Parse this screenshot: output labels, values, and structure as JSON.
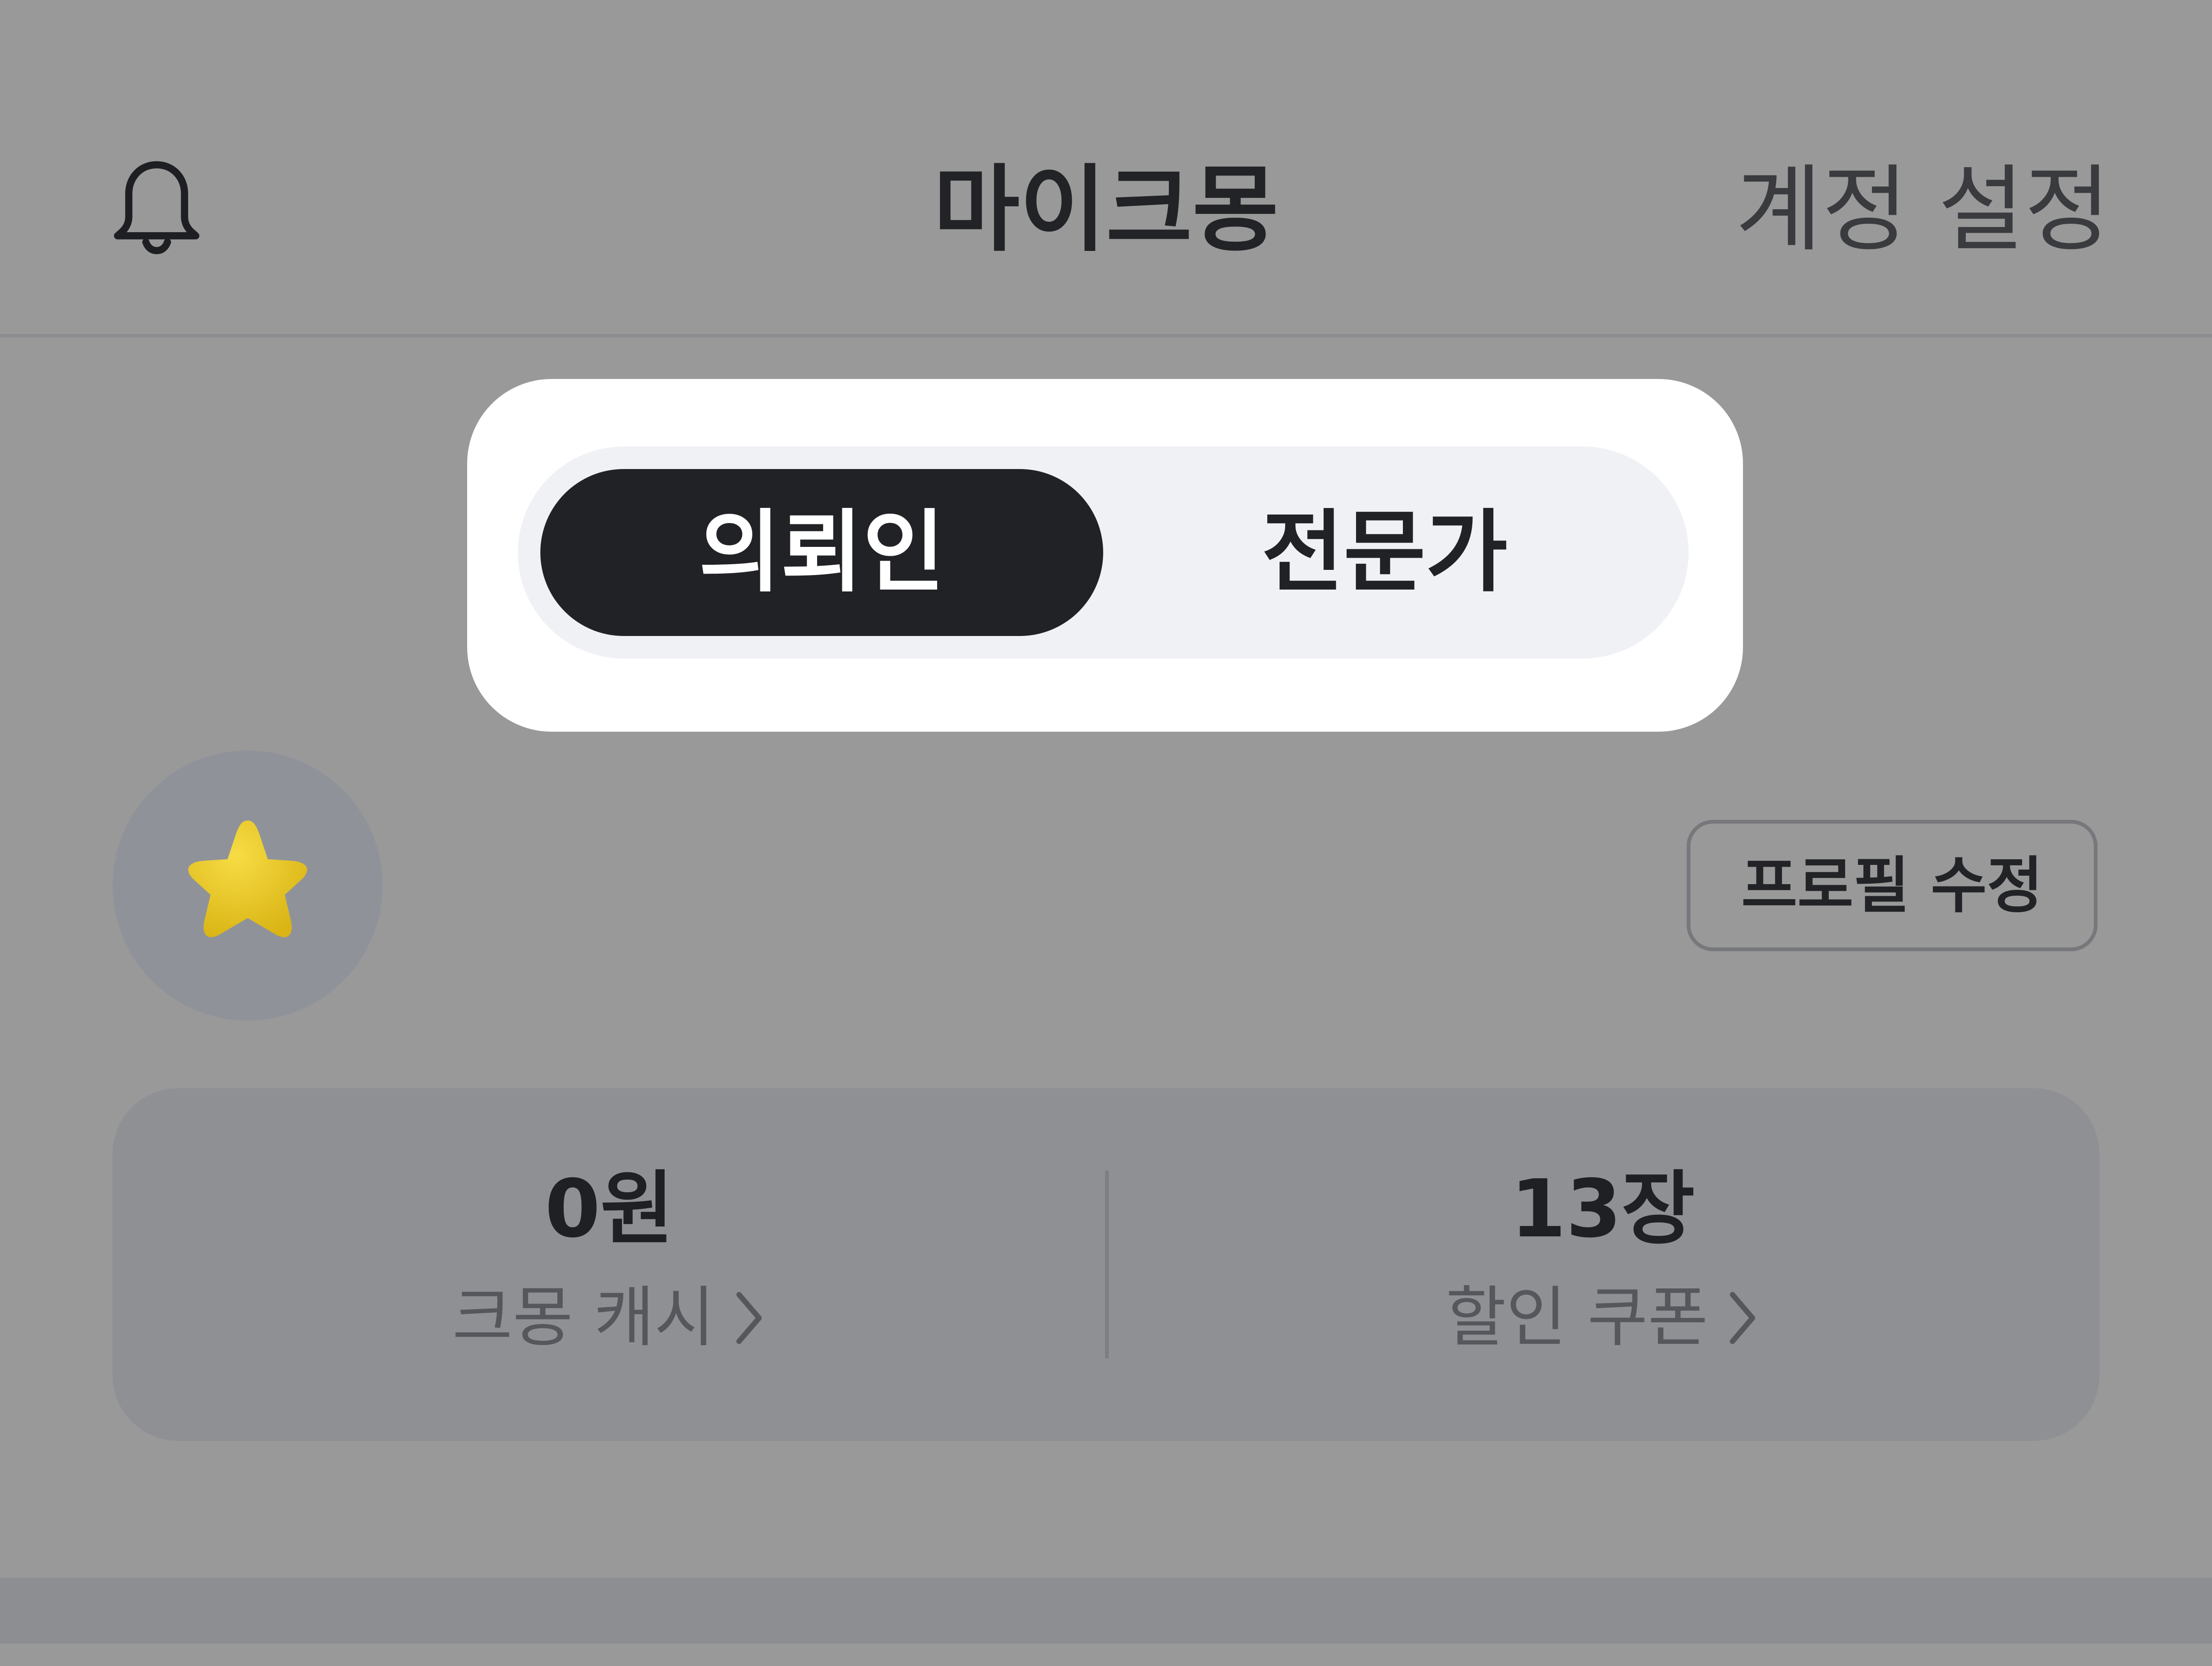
{
  "header": {
    "title": "마이크몽",
    "account_settings": "계정 설정",
    "notification_icon": "bell-icon"
  },
  "role_toggle": {
    "options": [
      "의뢰인",
      "전문가"
    ],
    "selected": "의뢰인"
  },
  "profile": {
    "avatar_icon": "star-icon",
    "edit_label": "프로필 수정"
  },
  "stats": {
    "cash": {
      "value": "0원",
      "label": "크몽 캐시"
    },
    "coupons": {
      "value": "13장",
      "label": "할인 쿠폰"
    }
  },
  "colors": {
    "overlay_gray": "#999999",
    "toggle_active_bg": "#212226",
    "toggle_track": "#f0f1f5",
    "avatar_star": "#f0cc2a"
  }
}
